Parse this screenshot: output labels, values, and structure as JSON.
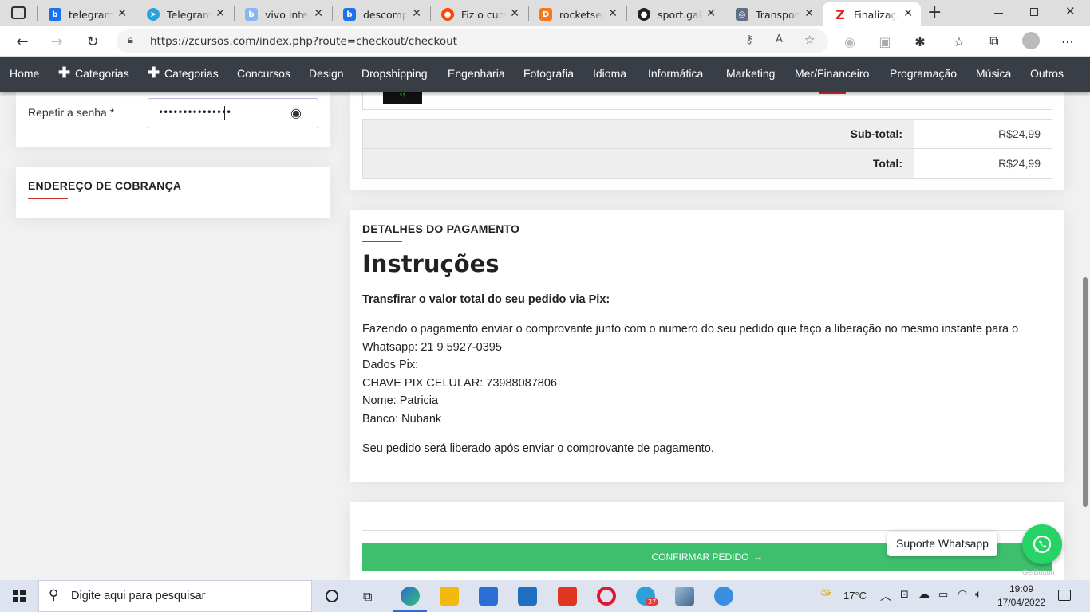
{
  "browser": {
    "tabs": [
      {
        "title": "telegram c",
        "icon": "bing-icon",
        "color": "#1a73e8"
      },
      {
        "title": "Telegram D",
        "icon": "telegram-icon",
        "color": "#2aa1da"
      },
      {
        "title": "vivo intern",
        "icon": "bing-icon",
        "color": "#8ab4f8"
      },
      {
        "title": "descompa",
        "icon": "bing-icon",
        "color": "#1a73e8"
      },
      {
        "title": "Fiz o curso",
        "icon": "reddit-icon",
        "color": "#ff4500"
      },
      {
        "title": "rocketseat",
        "icon": "d-icon",
        "color": "#f47920"
      },
      {
        "title": "sport.galer",
        "icon": "github-icon",
        "color": "#222222"
      },
      {
        "title": "Transporta",
        "icon": "globe-icon",
        "color": "#5f6f86"
      },
      {
        "title": "Finalizaçã",
        "icon": "z-icon",
        "color": "#e02020"
      }
    ],
    "url": "https://zcursos.com/index.php?route=checkout/checkout"
  },
  "menu": {
    "items": [
      "Home",
      "Categorias",
      "Categorias",
      "Concursos",
      "Design",
      "Dropshipping",
      "Engenharia",
      "Fotografia",
      "Idioma",
      "Informática",
      "Marketing",
      "Mer/Financeiro",
      "Programação",
      "Música",
      "Outros"
    ]
  },
  "account": {
    "repeat_password_label": "Repetir a senha *",
    "password_mask": "•••••••••••••••"
  },
  "billing": {
    "heading": "ENDEREÇO DE COBRANÇA"
  },
  "totals": {
    "subtotal_label": "Sub-total:",
    "subtotal_value": "R$24,99",
    "total_label": "Total:",
    "total_value": "R$24,99"
  },
  "payment": {
    "heading": "DETALHES DO PAGAMENTO",
    "title": "Instruções",
    "subtitle": "Transfirar o valor total do seu pedido via Pix:",
    "line1": "Fazendo o pagamento enviar o comprovante junto com o numero do seu pedido que faço a liberação no mesmo instante para o",
    "line2": "Whatsapp: 21 9 5927-0395",
    "line3": "Dados Pix:",
    "line4": "CHAVE PIX CELULAR: 73988087806",
    "line5": "Nome: Patricia",
    "line6": "Banco: Nubank",
    "footer": "Seu pedido será liberado após enviar o comprovante de pagamento."
  },
  "confirm": {
    "button": "CONFIRMAR PEDIDO"
  },
  "whatsapp": {
    "label": "Suporte Whatsapp",
    "getbutton": "GetButton"
  },
  "taskbar": {
    "search_placeholder": "Digite aqui para pesquisar",
    "temperature": "17°C",
    "time": "19:09",
    "date": "17/04/2022",
    "telegram_badge": "37"
  },
  "colors": {
    "accent_red": "#d32f2f",
    "green": "#3dbf6e",
    "menu_bg": "#393d45",
    "whatsapp": "#25d366"
  }
}
